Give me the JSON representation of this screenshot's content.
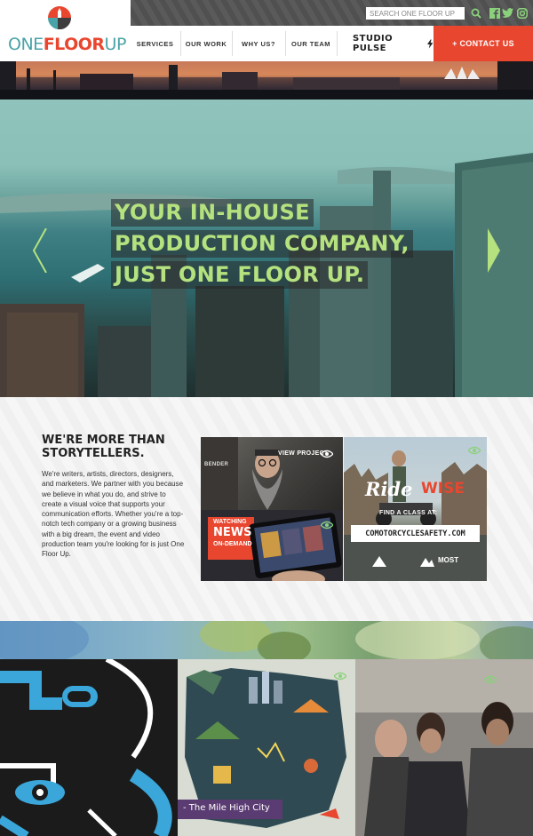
{
  "brand": {
    "logo_one": "ONE",
    "logo_floor": "FLOOR",
    "logo_up": "UP"
  },
  "search": {
    "placeholder": "SEARCH ONE FLOOR UP"
  },
  "social": {
    "search_icon": "search-icon",
    "facebook_icon": "facebook-icon",
    "twitter_icon": "twitter-icon",
    "instagram_icon": "instagram-icon"
  },
  "nav": {
    "items": [
      {
        "label": "SERVICES"
      },
      {
        "label": "OUR WORK"
      },
      {
        "label": "WHY US?"
      },
      {
        "label": "OUR TEAM"
      }
    ],
    "studio_pulse": "STUDIO PULSE",
    "contact": "+ CONTACT US"
  },
  "hero": {
    "lines": [
      "YOUR IN-HOUSE",
      "PRODUCTION COMPANY,",
      "JUST ONE FLOOR UP."
    ]
  },
  "intro": {
    "title": "WE'RE MORE THAN STORYTELLERS.",
    "body": "We're writers, artists, directors, designers, and marketers. We partner with you because we believe in what you do, and strive to create a visual voice that supports your communication efforts. Whether you're a top-notch tech company or a growing business with a big dream, the event and video production team you're looking for is just One Floor Up."
  },
  "portfolio": {
    "view_project": "VIEW PROJECT",
    "tile_bender": "BENDER",
    "tile_watching": "WATCHING",
    "tile_news": "NEWS",
    "tile_ondemand": "ON-DEMAND",
    "ride": "Ride",
    "wise": "WISE",
    "find_class": "FIND A CLASS AT:",
    "domain": "COMOTORCYCLESAFETY.COM",
    "most": "MOST"
  },
  "bottom": {
    "map_caption": "- The Mile High City"
  },
  "colors": {
    "accent_red": "#e9462f",
    "accent_green": "#8bd17c",
    "headline_green": "#b5e27f",
    "teal": "#4aa3a8"
  }
}
